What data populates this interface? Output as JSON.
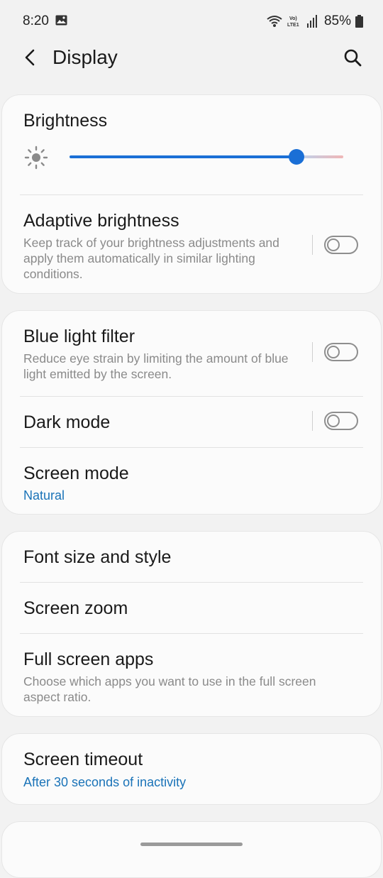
{
  "status_bar": {
    "time": "8:20",
    "network_label": "Vo) LTE1",
    "battery": "85%"
  },
  "header": {
    "title": "Display",
    "back_icon": "back-arrow-icon",
    "search_icon": "search-icon"
  },
  "brightness": {
    "title": "Brightness",
    "level": 0.83,
    "icon": "sun-icon",
    "accent": "#1a6fd6"
  },
  "adaptive_brightness": {
    "title": "Adaptive brightness",
    "description": "Keep track of your brightness adjustments and apply them automatically in similar lighting conditions.",
    "enabled": false
  },
  "blue_light_filter": {
    "title": "Blue light filter",
    "description": "Reduce eye strain by limiting the amount of blue light emitted by the screen.",
    "enabled": false
  },
  "dark_mode": {
    "title": "Dark mode",
    "enabled": false
  },
  "screen_mode": {
    "title": "Screen mode",
    "value": "Natural"
  },
  "font_size": {
    "title": "Font size and style"
  },
  "screen_zoom": {
    "title": "Screen zoom"
  },
  "full_screen_apps": {
    "title": "Full screen apps",
    "description": "Choose which apps you want to use in the full screen aspect ratio."
  },
  "screen_timeout": {
    "title": "Screen timeout",
    "value": "After 30 seconds of inactivity"
  },
  "colors": {
    "link": "#1a73b8",
    "background": "#f2f2f2"
  }
}
